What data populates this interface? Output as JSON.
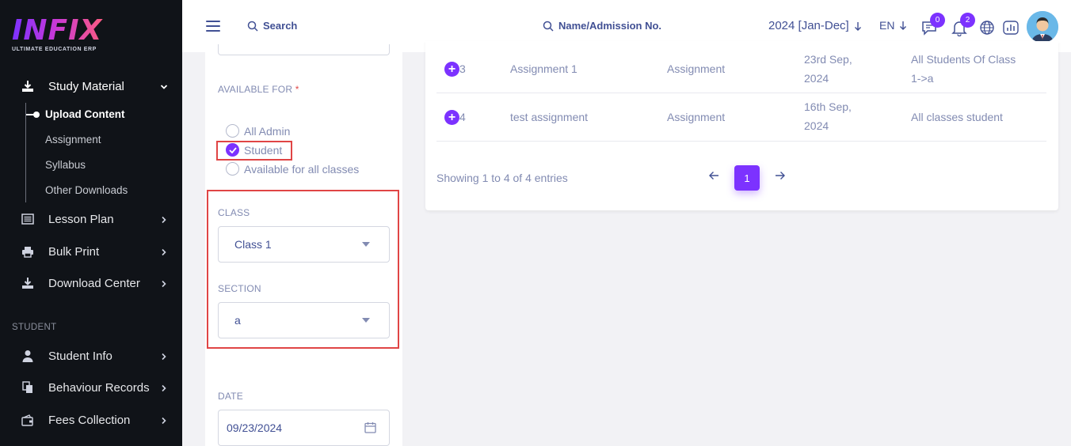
{
  "brand": {
    "logo_text": "INFIX",
    "tagline": "ULTIMATE EDUCATION ERP"
  },
  "sidebar": {
    "study_material": {
      "label": "Study Material"
    },
    "sub_items": [
      {
        "label": "Upload Content",
        "active": true
      },
      {
        "label": "Assignment"
      },
      {
        "label": "Syllabus"
      },
      {
        "label": "Other Downloads"
      }
    ],
    "items": [
      {
        "label": "Lesson Plan"
      },
      {
        "label": "Bulk Print"
      },
      {
        "label": "Download Center"
      }
    ],
    "section_student": "STUDENT",
    "student_items": [
      {
        "label": "Student Info"
      },
      {
        "label": "Behaviour Records"
      },
      {
        "label": "Fees Collection"
      }
    ]
  },
  "header": {
    "search_label": "Search",
    "search_student_label": "Name/Admission No.",
    "year": "2024 [Jan-Dec]",
    "language": "EN",
    "messages_count": "0",
    "notifications_count": "2"
  },
  "form": {
    "available_for_label": "AVAILABLE FOR",
    "required_mark": "*",
    "options": [
      {
        "label": "All Admin",
        "checked": false
      },
      {
        "label": "Student",
        "checked": true
      },
      {
        "label": "Available for all classes",
        "checked": false
      }
    ],
    "class_label": "CLASS",
    "class_value": "Class 1",
    "section_label": "SECTION",
    "section_value": "a",
    "date_label": "DATE",
    "date_value": "09/23/2024"
  },
  "table": {
    "rows": [
      {
        "num": "3",
        "title": "Assignment 1",
        "type": "Assignment",
        "date_line1": "23rd Sep,",
        "date_line2": "2024",
        "avail_line1": "All Students Of Class",
        "avail_line2": "1->a"
      },
      {
        "num": "4",
        "title": "test assignment",
        "type": "Assignment",
        "date_line1": "16th Sep,",
        "date_line2": "2024",
        "avail_line1": "All classes student",
        "avail_line2": ""
      }
    ],
    "showing_text": "Showing 1 to 4 of 4 entries",
    "current_page": "1"
  },
  "colors": {
    "accent": "#7c32ff",
    "sidebar_bg": "#101318",
    "text": "#415094",
    "muted": "#828bb2",
    "highlight": "#e04545"
  }
}
